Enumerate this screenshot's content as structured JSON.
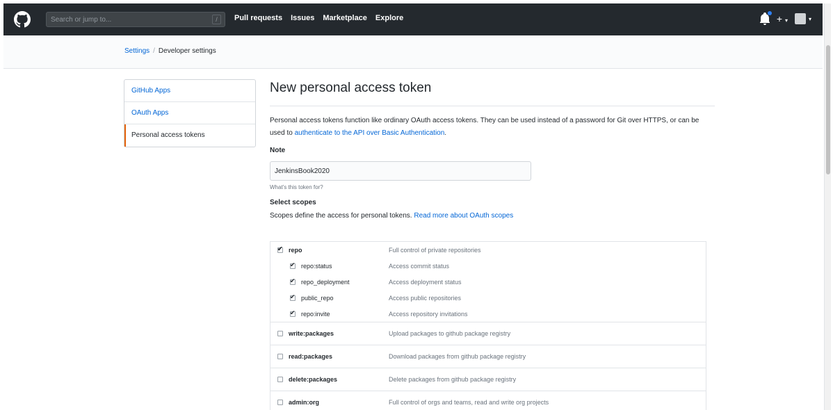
{
  "header": {
    "search_placeholder": "Search or jump to...",
    "slash_key": "/",
    "nav": [
      "Pull requests",
      "Issues",
      "Marketplace",
      "Explore"
    ],
    "plus": "+",
    "caret": "▾"
  },
  "breadcrumb": {
    "settings": "Settings",
    "sep": "/",
    "current": "Developer settings"
  },
  "sidebar": {
    "items": [
      {
        "label": "GitHub Apps"
      },
      {
        "label": "OAuth Apps"
      },
      {
        "label": "Personal access tokens"
      }
    ]
  },
  "page": {
    "title": "New personal access token",
    "description_prefix": "Personal access tokens function like ordinary OAuth access tokens. They can be used instead of a password for Git over HTTPS, or can be used to ",
    "description_link": "authenticate to the API over Basic Authentication",
    "description_suffix": ".",
    "note_label": "Note",
    "note_value": "JenkinsBook2020",
    "note_hint": "What's this token for?",
    "scopes_title": "Select scopes",
    "scopes_desc_prefix": "Scopes define the access for personal tokens. ",
    "scopes_desc_link": "Read more about OAuth scopes"
  },
  "scopes": [
    {
      "name": "repo",
      "desc": "Full control of private repositories",
      "checked": true
    },
    {
      "name": "repo:status",
      "desc": "Access commit status",
      "checked": true
    },
    {
      "name": "repo_deployment",
      "desc": "Access deployment status",
      "checked": true
    },
    {
      "name": "public_repo",
      "desc": "Access public repositories",
      "checked": true
    },
    {
      "name": "repo:invite",
      "desc": "Access repository invitations",
      "checked": true
    },
    {
      "name": "write:packages",
      "desc": "Upload packages to github package registry",
      "checked": false
    },
    {
      "name": "read:packages",
      "desc": "Download packages from github package registry",
      "checked": false
    },
    {
      "name": "delete:packages",
      "desc": "Delete packages from github package registry",
      "checked": false
    },
    {
      "name": "admin:org",
      "desc": "Full control of orgs and teams, read and write org projects",
      "checked": false
    }
  ],
  "colors": {
    "header_bg": "#24292e",
    "link": "#0366d6",
    "selected_accent": "#e36209",
    "notification_dot": "#2f81f7"
  }
}
